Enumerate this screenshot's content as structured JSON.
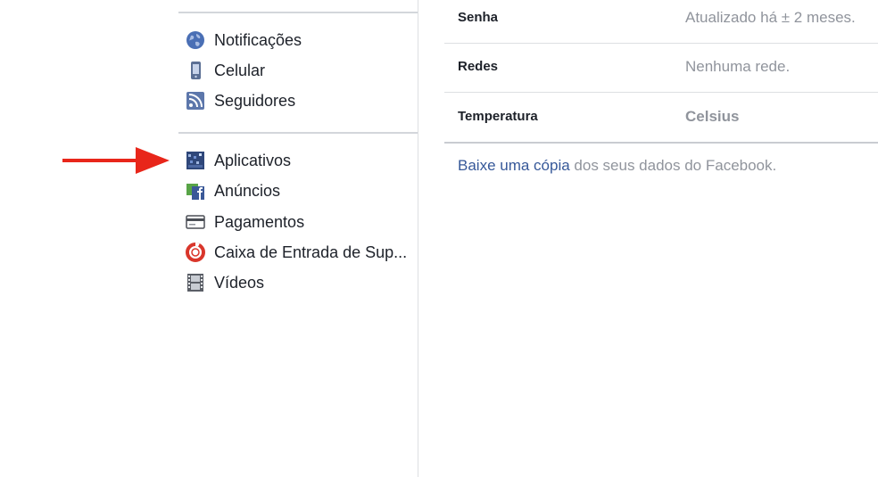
{
  "sidebar": {
    "group1": [
      {
        "label": "Notificações",
        "icon": "globe-icon"
      },
      {
        "label": "Celular",
        "icon": "mobile-phone-icon"
      },
      {
        "label": "Seguidores",
        "icon": "rss-feed-icon"
      }
    ],
    "group2": [
      {
        "label": "Aplicativos",
        "icon": "apps-grid-icon"
      },
      {
        "label": "Anúncios",
        "icon": "ads-icon"
      },
      {
        "label": "Pagamentos",
        "icon": "credit-card-icon"
      },
      {
        "label": "Caixa de Entrada de Sup...",
        "icon": "lifebuoy-icon"
      },
      {
        "label": "Vídeos",
        "icon": "film-strip-icon"
      }
    ]
  },
  "settings": {
    "rows": [
      {
        "key": "Senha",
        "value": "Atualizado há ± 2 meses."
      },
      {
        "key": "Redes",
        "value": "Nenhuma rede."
      },
      {
        "key": "Temperatura",
        "value": "Celsius"
      }
    ],
    "download_link": "Baixe uma cópia",
    "download_rest": " dos seus dados do Facebook."
  },
  "colors": {
    "link": "#365899",
    "muted": "#90949c",
    "annotation_arrow": "#e8261a"
  }
}
